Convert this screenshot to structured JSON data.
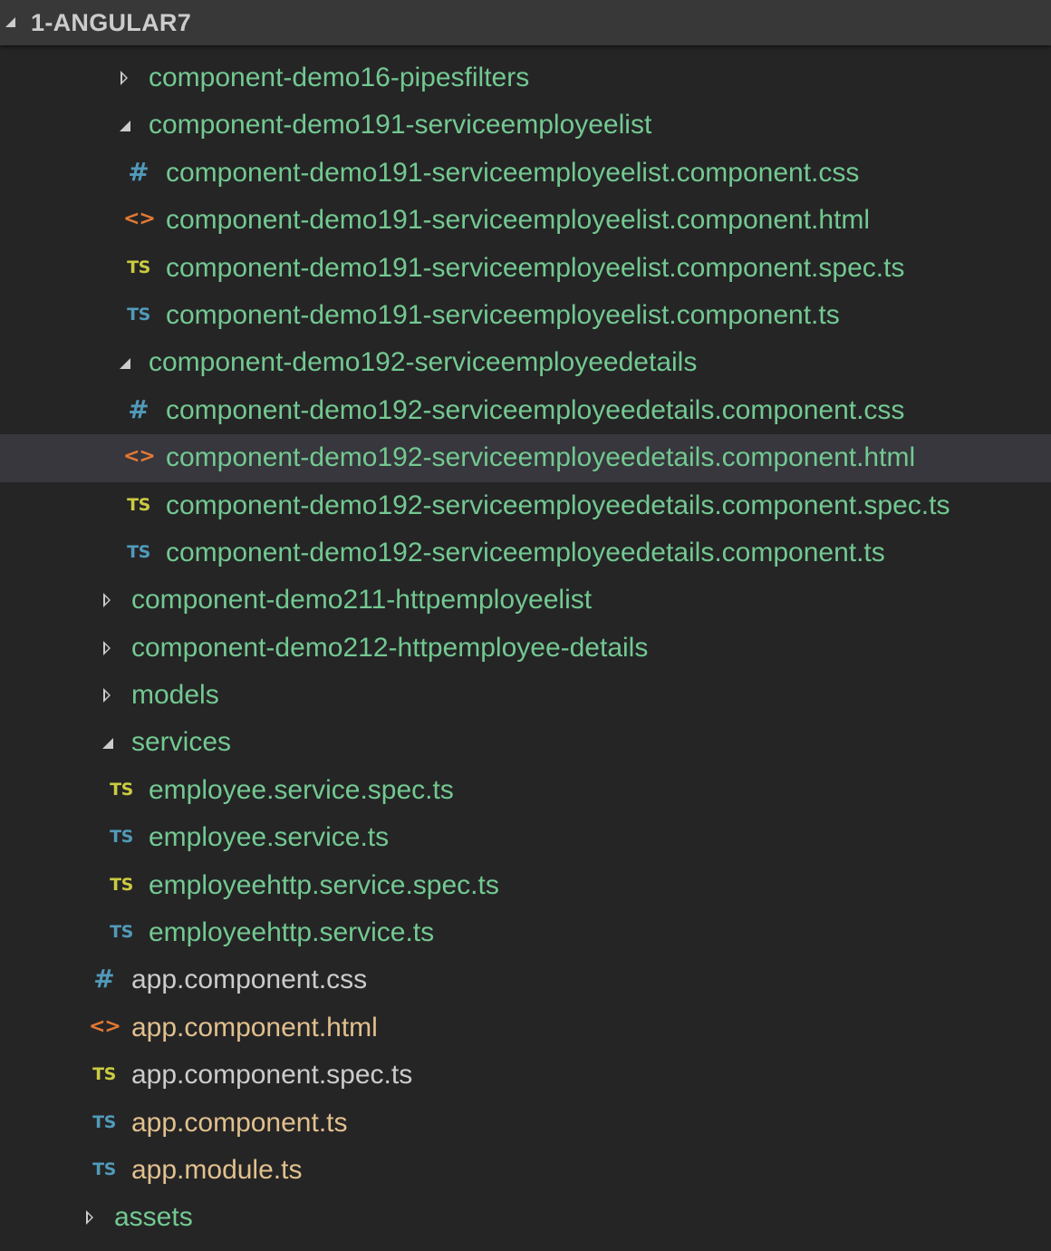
{
  "explorer": {
    "root_title": "1-ANGULAR7",
    "colors": {
      "background": "#252526",
      "header_background": "#383838",
      "selected_row": "#37373d",
      "untracked_green": "#73c991",
      "modified_orange": "#e2c08d",
      "default_text": "#cccccc",
      "css_icon": "#519aba",
      "html_icon": "#e37933",
      "ts_icon": "#519aba",
      "spec_icon": "#cbcb41"
    },
    "items": [
      {
        "label": "component-demo16-pipesfilters",
        "kind": "folder",
        "state": "collapsed"
      },
      {
        "label": "component-demo191-serviceemployeelist",
        "kind": "folder",
        "state": "expanded"
      },
      {
        "label": "component-demo191-serviceemployeelist.component.css",
        "kind": "file",
        "icon_text": "#",
        "icon_name": "css-file-icon"
      },
      {
        "label": "component-demo191-serviceemployeelist.component.html",
        "kind": "file",
        "icon_text": "<>",
        "icon_name": "html-file-icon"
      },
      {
        "label": "component-demo191-serviceemployeelist.component.spec.ts",
        "kind": "file",
        "icon_text": "TS",
        "icon_name": "ts-spec-file-icon"
      },
      {
        "label": "component-demo191-serviceemployeelist.component.ts",
        "kind": "file",
        "icon_text": "TS",
        "icon_name": "ts-file-icon"
      },
      {
        "label": "component-demo192-serviceemployeedetails",
        "kind": "folder",
        "state": "expanded"
      },
      {
        "label": "component-demo192-serviceemployeedetails.component.css",
        "kind": "file",
        "icon_text": "#",
        "icon_name": "css-file-icon"
      },
      {
        "label": "component-demo192-serviceemployeedetails.component.html",
        "kind": "file",
        "icon_text": "<>",
        "icon_name": "html-file-icon",
        "selected": true
      },
      {
        "label": "component-demo192-serviceemployeedetails.component.spec.ts",
        "kind": "file",
        "icon_text": "TS",
        "icon_name": "ts-spec-file-icon"
      },
      {
        "label": "component-demo192-serviceemployeedetails.component.ts",
        "kind": "file",
        "icon_text": "TS",
        "icon_name": "ts-file-icon"
      },
      {
        "label": "component-demo211-httpemployeelist",
        "kind": "folder",
        "state": "collapsed"
      },
      {
        "label": "component-demo212-httpemployee-details",
        "kind": "folder",
        "state": "collapsed"
      },
      {
        "label": "models",
        "kind": "folder",
        "state": "collapsed"
      },
      {
        "label": "services",
        "kind": "folder",
        "state": "expanded"
      },
      {
        "label": "employee.service.spec.ts",
        "kind": "file",
        "icon_text": "TS",
        "icon_name": "ts-spec-file-icon"
      },
      {
        "label": "employee.service.ts",
        "kind": "file",
        "icon_text": "TS",
        "icon_name": "ts-file-icon"
      },
      {
        "label": "employeehttp.service.spec.ts",
        "kind": "file",
        "icon_text": "TS",
        "icon_name": "ts-spec-file-icon"
      },
      {
        "label": "employeehttp.service.ts",
        "kind": "file",
        "icon_text": "TS",
        "icon_name": "ts-file-icon"
      },
      {
        "label": "app.component.css",
        "kind": "file",
        "icon_text": "#",
        "icon_name": "css-file-icon"
      },
      {
        "label": "app.component.html",
        "kind": "file",
        "icon_text": "<>",
        "icon_name": "html-file-icon"
      },
      {
        "label": "app.component.spec.ts",
        "kind": "file",
        "icon_text": "TS",
        "icon_name": "ts-spec-file-icon"
      },
      {
        "label": "app.component.ts",
        "kind": "file",
        "icon_text": "TS",
        "icon_name": "ts-file-icon"
      },
      {
        "label": "app.module.ts",
        "kind": "file",
        "icon_text": "TS",
        "icon_name": "ts-file-icon"
      },
      {
        "label": "assets",
        "kind": "folder",
        "state": "collapsed"
      }
    ]
  }
}
